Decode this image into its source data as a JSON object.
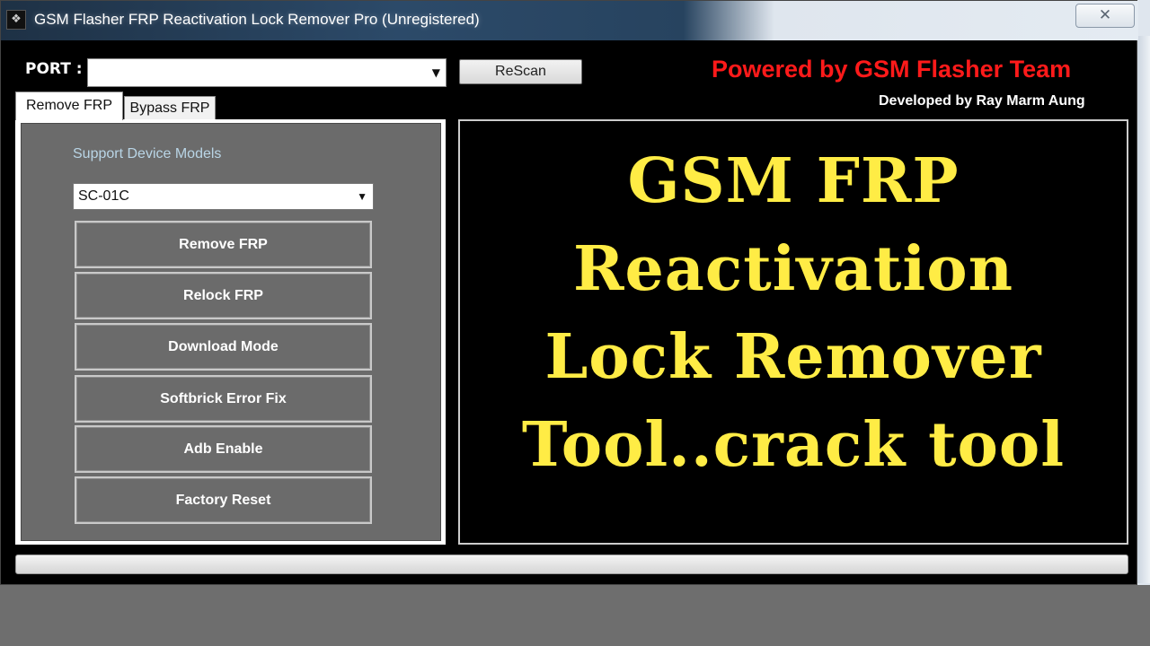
{
  "window": {
    "title": "GSM Flasher FRP Reactivation Lock Remover Pro (Unregistered)",
    "close_glyph": "✕"
  },
  "port": {
    "label": "PORT :",
    "value": "",
    "rescan_label": "ReScan"
  },
  "branding": {
    "powered_by": "Powered by GSM Flasher Team",
    "developed_by": "Developed by Ray Marm Aung"
  },
  "tabs": [
    {
      "label": "Remove FRP",
      "active": true
    },
    {
      "label": "Bypass FRP",
      "active": false
    }
  ],
  "left_panel": {
    "support_label": "Support Device Models",
    "selected_model": "SC-01C",
    "buttons": [
      "Remove FRP",
      "Relock FRP",
      "Download Mode",
      "Softbrick Error Fix",
      "Adb Enable",
      "Factory Reset"
    ]
  },
  "banner": {
    "lines": [
      "GSM FRP",
      "Reactivation",
      "Lock Remover",
      "Tool..crack tool"
    ],
    "color": "#ffec45"
  },
  "progress": {
    "value": 0
  },
  "colors": {
    "powered_text": "#ff1a1a",
    "panel_gray": "#6b6b6b",
    "window_bg": "#000000"
  }
}
